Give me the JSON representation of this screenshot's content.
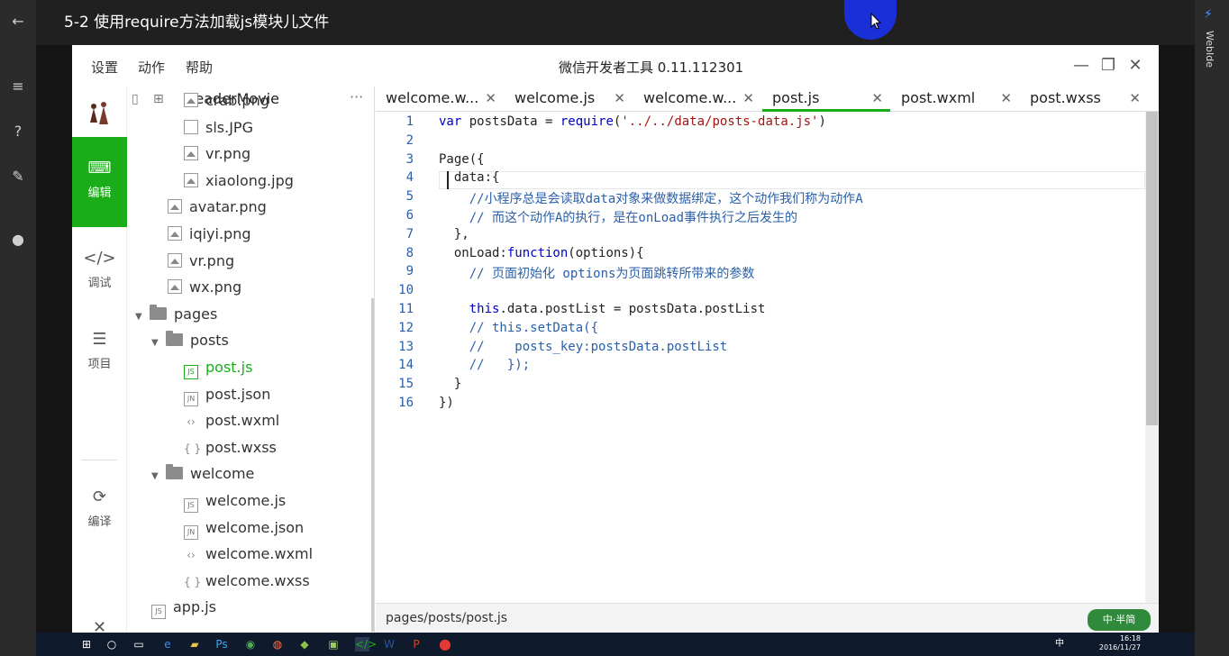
{
  "video_title": "5-2 使用require方法加载js模块儿文件",
  "player": {
    "side_label": "WebIde"
  },
  "window": {
    "title": "微信开发者工具 0.11.112301",
    "menu": [
      "设置",
      "动作",
      "帮助"
    ]
  },
  "leftbar": {
    "items": [
      "编辑",
      "调试",
      "项目",
      "编译",
      "关闭"
    ]
  },
  "filetree": {
    "project": "ReaderMovie",
    "nodes": [
      {
        "label": "crab.png",
        "kind": "img",
        "depth": 3
      },
      {
        "label": "sls.JPG",
        "kind": "file",
        "depth": 3
      },
      {
        "label": "vr.png",
        "kind": "img",
        "depth": 3
      },
      {
        "label": "xiaolong.jpg",
        "kind": "img",
        "depth": 3
      },
      {
        "label": "avatar.png",
        "kind": "img",
        "depth": 2
      },
      {
        "label": "iqiyi.png",
        "kind": "img",
        "depth": 2
      },
      {
        "label": "vr.png",
        "kind": "img",
        "depth": 2
      },
      {
        "label": "wx.png",
        "kind": "img",
        "depth": 2
      },
      {
        "label": "pages",
        "kind": "folder",
        "depth": 1
      },
      {
        "label": "posts",
        "kind": "folder",
        "depth": 2
      },
      {
        "label": "post.js",
        "kind": "js",
        "depth": 3,
        "selected": true
      },
      {
        "label": "post.json",
        "kind": "json",
        "depth": 3
      },
      {
        "label": "post.wxml",
        "kind": "wxml",
        "depth": 3
      },
      {
        "label": "post.wxss",
        "kind": "wxss",
        "depth": 3
      },
      {
        "label": "welcome",
        "kind": "folder",
        "depth": 2
      },
      {
        "label": "welcome.js",
        "kind": "js",
        "depth": 3
      },
      {
        "label": "welcome.json",
        "kind": "json",
        "depth": 3
      },
      {
        "label": "welcome.wxml",
        "kind": "wxml",
        "depth": 3
      },
      {
        "label": "welcome.wxss",
        "kind": "wxss",
        "depth": 3
      },
      {
        "label": "app.js",
        "kind": "js",
        "depth": 1
      }
    ]
  },
  "tabs": [
    {
      "label": "welcome.w...",
      "active": false
    },
    {
      "label": "welcome.js",
      "active": false
    },
    {
      "label": "welcome.w...",
      "active": false
    },
    {
      "label": "post.js",
      "active": true
    },
    {
      "label": "post.wxml",
      "active": false
    },
    {
      "label": "post.wxss",
      "active": false
    }
  ],
  "editor": {
    "lines": [
      "var postsData = require('../../data/posts-data.js')",
      "",
      "Page({",
      "  data:{",
      "    //小程序总是会读取data对象来做数据绑定，这个动作我们称为动作A",
      "    // 而这个动作A的执行，是在onLoad事件执行之后发生的",
      "  },",
      "  onLoad:function(options){",
      "    // 页面初始化 options为页面跳转所带来的参数",
      "",
      "    this.data.postList = postsData.postList",
      "    // this.setData({",
      "    //    posts_key:postsData.postList",
      "    //   });",
      "  }",
      "})"
    ]
  },
  "status": {
    "path": "pages/posts/post.js"
  },
  "watermark": "中·半简",
  "taskbar": {
    "time": "16:18",
    "date": "2016/11/27",
    "ime": "中"
  }
}
